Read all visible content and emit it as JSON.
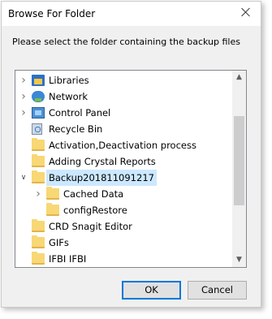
{
  "window": {
    "title": "Browse For Folder"
  },
  "prompt": "Please select the folder containing the backup files",
  "tree": {
    "items": [
      {
        "label": "Libraries",
        "icon": "libraries-icon",
        "expander": "closed",
        "level": 0
      },
      {
        "label": "Network",
        "icon": "network-icon",
        "expander": "closed",
        "level": 0
      },
      {
        "label": "Control Panel",
        "icon": "control-panel-icon",
        "expander": "closed",
        "level": 0
      },
      {
        "label": "Recycle Bin",
        "icon": "recycle-bin-icon",
        "expander": "none",
        "level": 0
      },
      {
        "label": "Activation,Deactivation process",
        "icon": "folder-icon",
        "expander": "none",
        "level": 0
      },
      {
        "label": "Adding Crystal Reports",
        "icon": "folder-icon",
        "expander": "none",
        "level": 0
      },
      {
        "label": "Backup201811091217",
        "icon": "folder-icon",
        "expander": "open",
        "level": 0,
        "selected": true
      },
      {
        "label": "Cached Data",
        "icon": "folder-icon",
        "expander": "closed",
        "level": 1
      },
      {
        "label": "configRestore",
        "icon": "folder-icon",
        "expander": "none",
        "level": 1
      },
      {
        "label": "CRD Snagit Editor",
        "icon": "folder-icon",
        "expander": "none",
        "level": 0
      },
      {
        "label": "GIFs",
        "icon": "folder-icon",
        "expander": "none",
        "level": 0
      },
      {
        "label": "IFBI IFBI",
        "icon": "folder-icon",
        "expander": "none",
        "level": 0
      }
    ]
  },
  "buttons": {
    "ok": "OK",
    "cancel": "Cancel"
  }
}
